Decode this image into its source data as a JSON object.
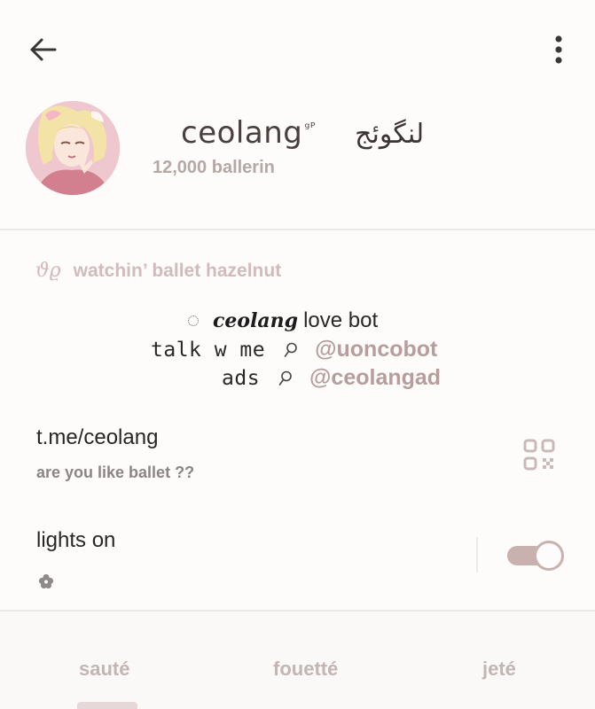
{
  "header": {
    "title": "ceolang",
    "title_deco": "ᵍᴾ",
    "title_alt": "لنگوئج",
    "subtitle": "12,000 ballerin"
  },
  "status": {
    "symbol": "ϑϱ",
    "text": "watchin’ ballet hazelnut"
  },
  "bio": {
    "line1_script": "ceolang",
    "line1_text": "love bot",
    "line2_label": "talk w me",
    "line2_handle": "@uoncobot",
    "line3_label": "ads",
    "line3_handle": "@ceolangad"
  },
  "link": {
    "url": "t.me/ceolang",
    "caption": "are you like ballet ??"
  },
  "lights": {
    "label": "lights on",
    "toggle_on": true
  },
  "tabs": [
    {
      "label": "sauté",
      "active": true
    },
    {
      "label": "fouetté",
      "active": false
    },
    {
      "label": "jeté",
      "active": false
    }
  ],
  "icons": {
    "back": "arrow-left-icon",
    "menu": "more-vertical-icon",
    "search": "magnifier-icon",
    "qr": "qr-code-icon",
    "flower": "flower-icon",
    "dotted_circle": "dotted-circle-icon"
  },
  "colors": {
    "accent": "#c9b1b0",
    "handle": "#b79d9b",
    "muted": "#c2b5b3"
  }
}
